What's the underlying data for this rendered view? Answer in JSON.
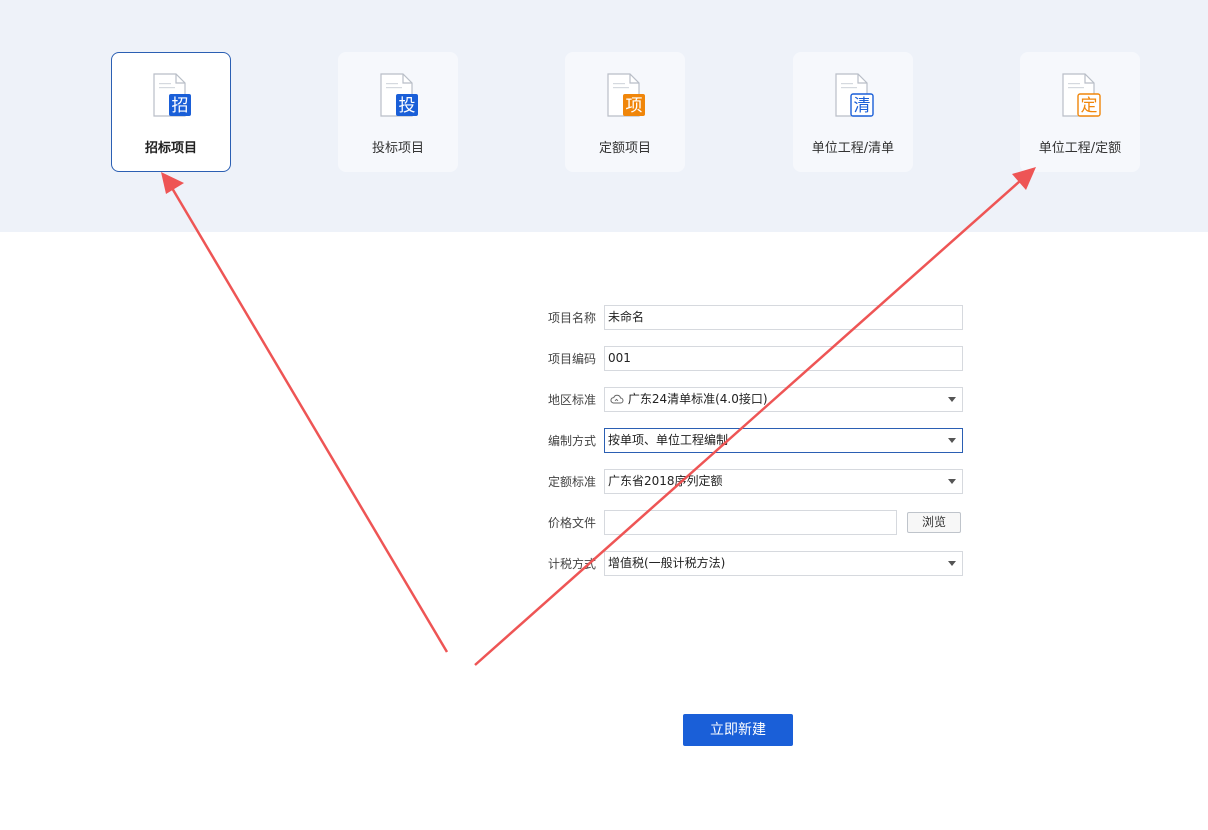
{
  "project_types": [
    {
      "label": "招标项目",
      "glyph": "招",
      "color": "#1a5fd8",
      "selected": true
    },
    {
      "label": "投标项目",
      "glyph": "投",
      "color": "#1a5fd8",
      "selected": false
    },
    {
      "label": "定额项目",
      "glyph": "项",
      "color": "#f0860a",
      "selected": false
    },
    {
      "label": "单位工程/清单",
      "glyph": "清",
      "color": "#1a5fd8",
      "selected": false
    },
    {
      "label": "单位工程/定额",
      "glyph": "定",
      "color": "#f0860a",
      "selected": false
    }
  ],
  "form": {
    "project_name": {
      "label": "项目名称",
      "value": "未命名"
    },
    "project_code": {
      "label": "项目编码",
      "value": "001"
    },
    "region_standard": {
      "label": "地区标准",
      "value": "广东24清单标准(4.0接口)",
      "icon": "cloud-icon"
    },
    "compile_method": {
      "label": "编制方式",
      "value": "按单项、单位工程编制"
    },
    "quota_standard": {
      "label": "定额标准",
      "value": "广东省2018序列定额"
    },
    "price_file": {
      "label": "价格文件",
      "value": "",
      "browse_label": "浏览"
    },
    "tax_method": {
      "label": "计税方式",
      "value": "增值税(一般计税方法)"
    }
  },
  "create_button_label": "立即新建",
  "colors": {
    "accent": "#1a5fd8",
    "annotation_arrow": "#ee5555",
    "top_band": "#eef2f9"
  }
}
